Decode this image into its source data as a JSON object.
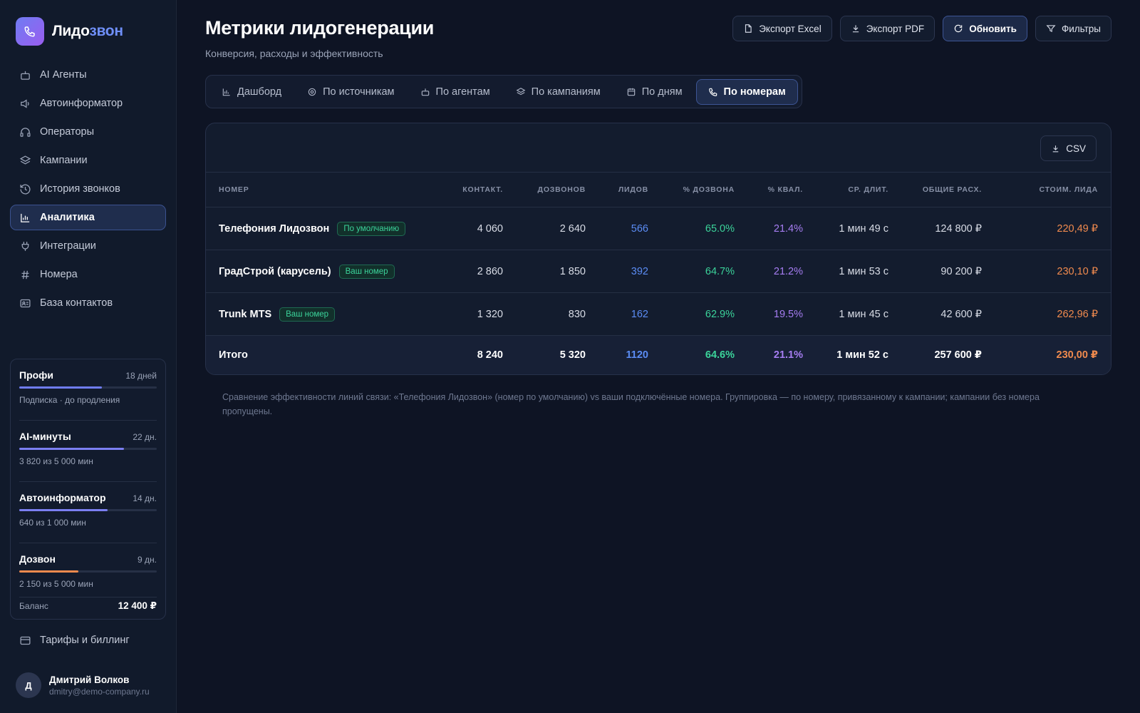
{
  "brand": {
    "name_part1": "Лидо",
    "name_part2": "звон"
  },
  "sidebar": {
    "items": [
      {
        "label": "AI Агенты",
        "icon": "robot-icon"
      },
      {
        "label": "Автоинформатор",
        "icon": "speaker-icon"
      },
      {
        "label": "Операторы",
        "icon": "headset-icon"
      },
      {
        "label": "Кампании",
        "icon": "layers-icon"
      },
      {
        "label": "История звонков",
        "icon": "history-icon"
      },
      {
        "label": "Аналитика",
        "icon": "chart-icon",
        "active": true
      },
      {
        "label": "Интеграции",
        "icon": "plug-icon"
      },
      {
        "label": "Номера",
        "icon": "hash-icon"
      },
      {
        "label": "База контактов",
        "icon": "contacts-icon"
      }
    ],
    "plans": [
      {
        "name": "Профи",
        "days": "18 дней",
        "sub": "Подписка · до продления",
        "progress": 0.6,
        "color": "#6f7cf2"
      },
      {
        "name": "AI-минуты",
        "days": "22 дн.",
        "sub": "3 820 из 5 000 мин",
        "progress": 0.764,
        "color": "#7b7ff2"
      },
      {
        "name": "Автоинформатор",
        "days": "14 дн.",
        "sub": "640 из 1 000 мин",
        "progress": 0.64,
        "color": "#7b7ff2"
      },
      {
        "name": "Дозвон",
        "days": "9 дн.",
        "sub": "2 150 из 5 000 мин",
        "progress": 0.43,
        "color": "#f08a4e"
      }
    ],
    "balance_label": "Баланс",
    "balance_value": "12 400 ₽",
    "billing_label": "Тарифы и биллинг",
    "user": {
      "initial": "Д",
      "name": "Дмитрий Волков",
      "email": "dmitry@demo-company.ru"
    }
  },
  "header": {
    "title": "Метрики лидогенерации",
    "subtitle": "Конверсия, расходы и эффективность",
    "buttons": {
      "export_excel": "Экспорт Excel",
      "export_pdf": "Экспорт PDF",
      "refresh": "Обновить",
      "filters": "Фильтры"
    }
  },
  "tabs": [
    {
      "label": "Дашборд",
      "icon": "bar-chart-icon"
    },
    {
      "label": "По источникам",
      "icon": "target-icon"
    },
    {
      "label": "По агентам",
      "icon": "robot-icon"
    },
    {
      "label": "По кампаниям",
      "icon": "layers-icon"
    },
    {
      "label": "По дням",
      "icon": "calendar-icon"
    },
    {
      "label": "По номерам",
      "icon": "phone-icon",
      "active": true
    }
  ],
  "table": {
    "csv_label": "CSV",
    "columns": [
      "НОМЕР",
      "КОНТАКТ.",
      "ДОЗВОНОВ",
      "ЛИДОВ",
      "% ДОЗВОНА",
      "% КВАЛ.",
      "СР. ДЛИТ.",
      "ОБЩИЕ РАСХ.",
      "СТОИМ. ЛИДА"
    ],
    "rows": [
      {
        "name": "Телефония Лидозвон",
        "tag": "По умолчанию",
        "contacts": "4 060",
        "calls": "2 640",
        "leads": "566",
        "call_rate": "65.0%",
        "qual_rate": "21.4%",
        "avg_dur": "1 мин 49 с",
        "spend": "124 800 ₽",
        "lead_cost": "220,49 ₽"
      },
      {
        "name": "ГрадСтрой (карусель)",
        "tag": "Ваш номер",
        "contacts": "2 860",
        "calls": "1 850",
        "leads": "392",
        "call_rate": "64.7%",
        "qual_rate": "21.2%",
        "avg_dur": "1 мин 53 с",
        "spend": "90 200 ₽",
        "lead_cost": "230,10 ₽"
      },
      {
        "name": "Trunk MTS",
        "tag": "Ваш номер",
        "contacts": "1 320",
        "calls": "830",
        "leads": "162",
        "call_rate": "62.9%",
        "qual_rate": "19.5%",
        "avg_dur": "1 мин 45 с",
        "spend": "42 600 ₽",
        "lead_cost": "262,96 ₽"
      }
    ],
    "total": {
      "name": "Итого",
      "contacts": "8 240",
      "calls": "5 320",
      "leads": "1120",
      "call_rate": "64.6%",
      "qual_rate": "21.1%",
      "avg_dur": "1 мин 52 с",
      "spend": "257 600 ₽",
      "lead_cost": "230,00 ₽"
    }
  },
  "footnote": "Сравнение эффективности линий связи: «Телефония Лидозвон» (номер по умолчанию) vs ваши подключённые номера. Группировка — по номеру, привязанному к кампании; кампании без номера пропущены.",
  "colors": {
    "accent": "#6f7cf2",
    "blue": "#5b8cf4",
    "green": "#3bd39a",
    "purple": "#a67df2",
    "orange": "#f08a4e"
  }
}
